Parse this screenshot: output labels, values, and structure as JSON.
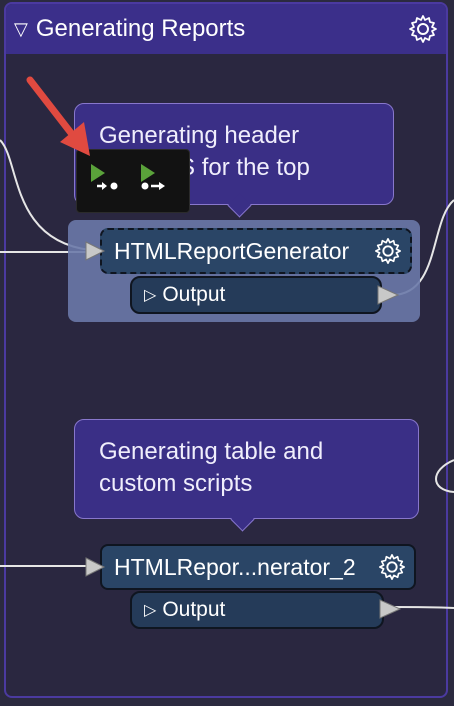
{
  "bookmark": {
    "title": "Generating Reports"
  },
  "annotations": [
    {
      "text_line1": "Generating header",
      "text_line2": "and CSS for the top"
    },
    {
      "text_line1": "Generating table and",
      "text_line2": "custom scripts"
    }
  ],
  "transformers": [
    {
      "name": "HTMLReportGenerator",
      "output_label": "Output"
    },
    {
      "name": "HTMLRepor...nerator_2",
      "output_label": "Output"
    }
  ],
  "toolbar": {
    "buttons": [
      "run-to-this-icon",
      "run-from-this-icon"
    ]
  },
  "colors": {
    "canvas": "#2b2a3f",
    "bookmark_header": "#3b2f8a",
    "transformer": "#2a4566",
    "selection": "#6a79a9",
    "run_green": "#5aa23a",
    "arrow_red": "#e04a40"
  }
}
